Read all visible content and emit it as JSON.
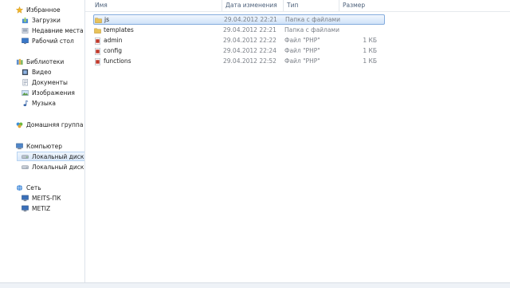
{
  "sidebar": {
    "favorites": {
      "label": "Избранное",
      "items": [
        {
          "label": "Загрузки",
          "icon": "downloads-icon"
        },
        {
          "label": "Недавние места",
          "icon": "recent-places-icon"
        },
        {
          "label": "Рабочий стол",
          "icon": "desktop-icon"
        }
      ]
    },
    "libraries": {
      "label": "Библиотеки",
      "items": [
        {
          "label": "Видео",
          "icon": "video-icon"
        },
        {
          "label": "Документы",
          "icon": "documents-icon"
        },
        {
          "label": "Изображения",
          "icon": "pictures-icon"
        },
        {
          "label": "Музыка",
          "icon": "music-icon"
        }
      ]
    },
    "homegroup": {
      "label": "Домашняя группа"
    },
    "computer": {
      "label": "Компьютер",
      "items": [
        {
          "label": "Локальный диск (C",
          "icon": "drive-icon"
        },
        {
          "label": "Локальный диск (D",
          "icon": "drive-icon"
        }
      ]
    },
    "network": {
      "label": "Сеть",
      "items": [
        {
          "label": "MEITS-ПК",
          "icon": "network-computer-icon"
        },
        {
          "label": "METIZ",
          "icon": "network-computer-icon"
        }
      ]
    }
  },
  "file_list": {
    "columns": {
      "name": "Имя",
      "date": "Дата изменения",
      "type": "Тип",
      "size": "Размер"
    },
    "rows": [
      {
        "name": "js",
        "date": "29.04.2012 22:21",
        "type": "Папка с файлами",
        "size": "",
        "kind": "folder"
      },
      {
        "name": "templates",
        "date": "29.04.2012 22:21",
        "type": "Папка с файлами",
        "size": "",
        "kind": "folder"
      },
      {
        "name": "admin",
        "date": "29.04.2012 22:22",
        "type": "Файл \"PHP\"",
        "size": "1 КБ",
        "kind": "php"
      },
      {
        "name": "config",
        "date": "29.04.2012 22:24",
        "type": "Файл \"PHP\"",
        "size": "1 КБ",
        "kind": "php"
      },
      {
        "name": "functions",
        "date": "29.04.2012 22:52",
        "type": "Файл \"PHP\"",
        "size": "1 КБ",
        "kind": "php"
      }
    ]
  },
  "colors": {
    "folder": "#e8c25a",
    "php": "#c0392b",
    "selection": "#cfe2f8",
    "selection_border": "#84acdd",
    "header_text": "#4c607a"
  }
}
